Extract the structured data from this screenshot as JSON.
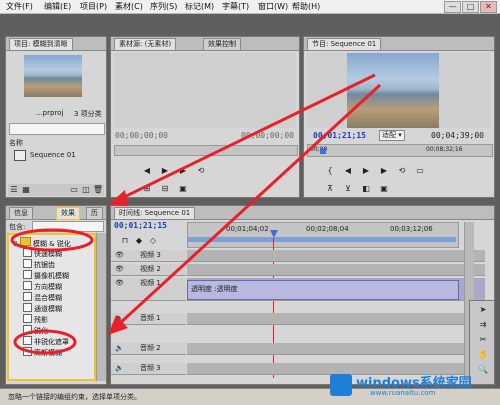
{
  "menu": [
    "文件(F)",
    "编辑(E)",
    "项目(P)",
    "素材(C)",
    "序列(S)",
    "标记(M)",
    "字幕(T)",
    "窗口(W)",
    "帮助(H)"
  ],
  "window_buttons": [
    "—",
    "□",
    "✕"
  ],
  "project_panel": {
    "tab": "项目: 模糊到清晰",
    "file_name": "...prproj",
    "item_count": "3 项分类",
    "column_name": "名称",
    "item": "Sequence 01"
  },
  "source_panel": {
    "tabs": [
      "素材源: (无素材)",
      "效果控制"
    ],
    "timecode_left": "00;00;00;00",
    "timecode_right": "00;00;00;00"
  },
  "program_panel": {
    "tab": "节目: Sequence 01",
    "timecode_current": "00;01;21;15",
    "fit": "适配",
    "duration": "00;04;39;00",
    "ruler_marks": [
      "00;00",
      "00;08;32;16"
    ]
  },
  "effects_panel": {
    "tabs": [
      "信息",
      "效果",
      "历"
    ],
    "contains_label": "包含:",
    "folder": "模糊 & 锐化",
    "items": [
      "快速模糊",
      "抗锯齿",
      "摄像机模糊",
      "方向模糊",
      "混合模糊",
      "通道模糊",
      "残影",
      "锐化",
      "非锐化遮罩",
      "高斯模糊"
    ]
  },
  "timeline": {
    "tab": "时间线: Sequence 01",
    "timecode": "00;01;21;15",
    "ruler": [
      "00;01;04;02",
      "00;02;08;04",
      "00;03;12;06"
    ],
    "video_tracks": [
      "视频 3",
      "视频 2",
      "视频 1"
    ],
    "clip_label": "透明度 :透明度",
    "audio_tracks": [
      "音频 1",
      "音频 2",
      "音频 3"
    ]
  },
  "status_text": "忽略一个链接的编组约束，选择单项分类。",
  "watermark": {
    "brand": "windows系统家园",
    "url": "www.ruanaitu.com"
  },
  "colors": {
    "accent_timecode": "#1a3fb5",
    "annotation_red": "#e8202a",
    "highlight_yellow": "#f2c230"
  }
}
